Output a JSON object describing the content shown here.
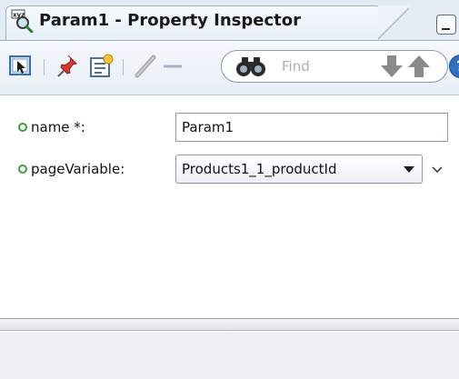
{
  "tab": {
    "title": "Param1 - Property Inspector",
    "icon": "property-inspector-icon"
  },
  "toolbar": {
    "icons": [
      "select-in-editor-icon",
      "pin-icon",
      "edit-properties-icon",
      "pencil-icon",
      "binoculars-icon",
      "arrow-down-icon",
      "arrow-up-icon",
      "help-icon"
    ],
    "find_placeholder": "Find",
    "help_label": "?"
  },
  "properties": [
    {
      "label": "name *:",
      "value": "Param1",
      "type": "text"
    },
    {
      "label": "pageVariable:",
      "value": "Products1_1_productId",
      "type": "select"
    }
  ],
  "colors": {
    "bullet": "#3aa138",
    "tab_background": "#e3ebf5",
    "help_button": "#2f6fc0"
  }
}
